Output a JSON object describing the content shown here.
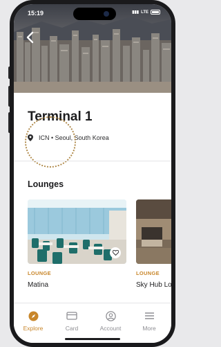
{
  "status_bar": {
    "time": "15:19",
    "network": "LTE"
  },
  "header": {
    "back_icon": "chevron-left-icon"
  },
  "terminal": {
    "title": "Terminal 1",
    "location": "ICN • Seoul, South Korea",
    "location_icon": "map-pin-icon"
  },
  "lounges": {
    "heading": "Lounges",
    "items": [
      {
        "tag": "LOUNGE",
        "name": "Matina",
        "favorite_icon": "heart-icon"
      },
      {
        "tag": "LOUNGE",
        "name": "Sky Hub Lounge"
      }
    ]
  },
  "tab_bar": {
    "tabs": [
      {
        "label": "Explore",
        "icon": "compass-icon",
        "active": true
      },
      {
        "label": "Card",
        "icon": "credit-card-icon",
        "active": false
      },
      {
        "label": "Account",
        "icon": "user-circle-icon",
        "active": false
      },
      {
        "label": "More",
        "icon": "menu-icon",
        "active": false
      }
    ]
  },
  "colors": {
    "accent": "#c8862a",
    "text": "#1c1c1e",
    "inactive": "#8e8e93"
  }
}
